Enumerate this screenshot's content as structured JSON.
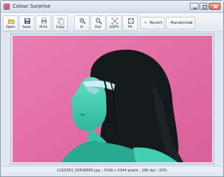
{
  "window": {
    "title": "Colour Surprise"
  },
  "toolbar": {
    "open": "Open",
    "save": "Save",
    "print": "Print",
    "copy": "Copy",
    "zoom_in": "In",
    "zoom_out": "Out",
    "actual_size": "100%",
    "fit": "Fit",
    "revert": "Revert",
    "randomize": "Randomize"
  },
  "status": {
    "info": "1210353_20838665.jpg : 3199 x 2044 pixels : 180 dpi : 20%"
  },
  "colors": {
    "photo_background": "#e36fa6",
    "skin_tint": "#3fd0b4",
    "hair": "#141a1a",
    "window_chrome": "#dfe7f1"
  }
}
